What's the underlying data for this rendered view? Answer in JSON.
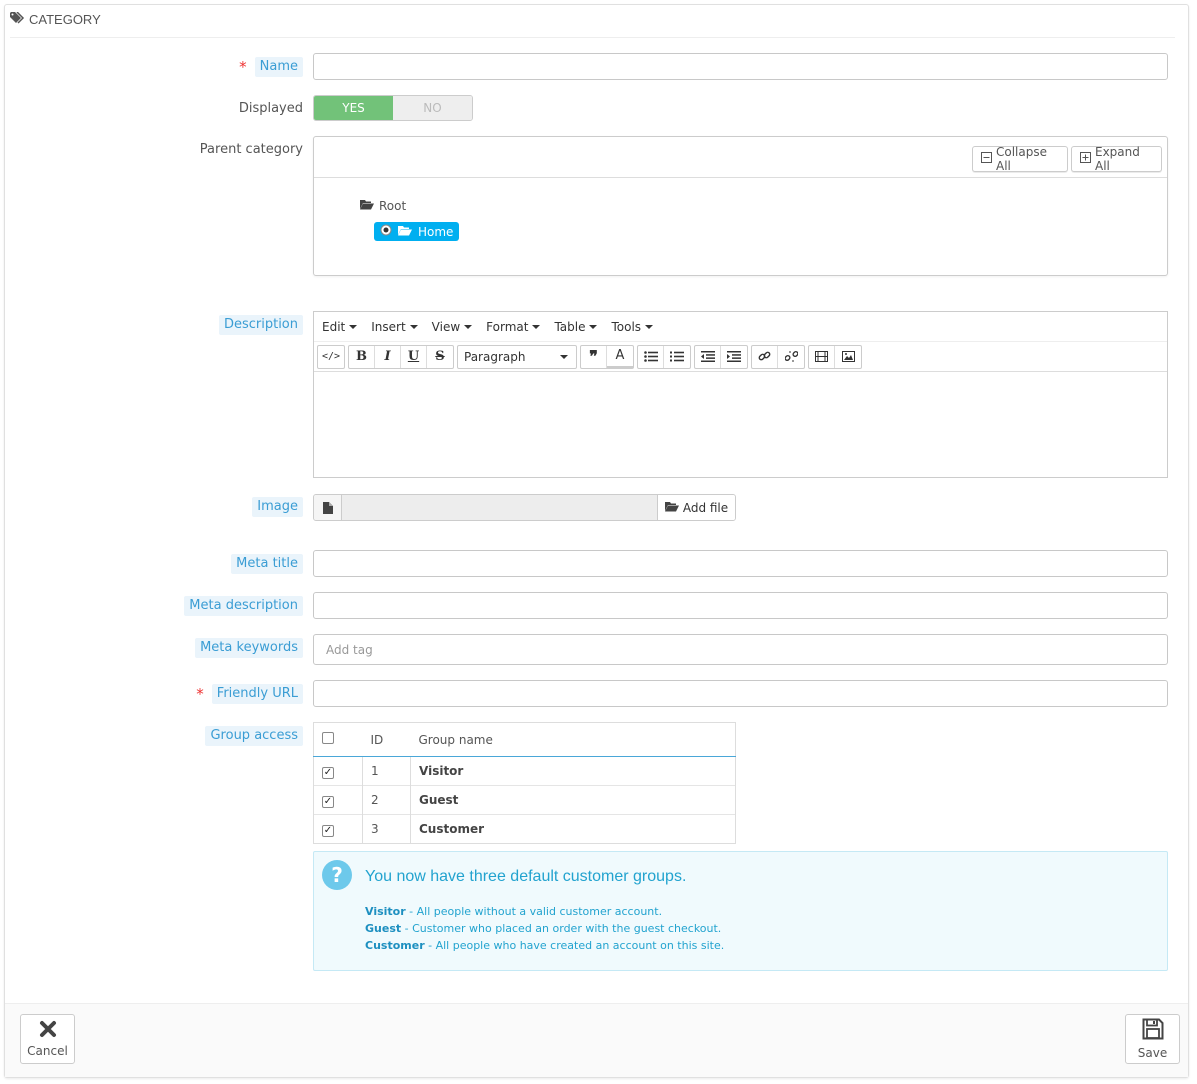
{
  "heading": {
    "title": "CATEGORY",
    "icon": "tags-icon"
  },
  "fields": {
    "name": {
      "label": "Name",
      "required": true,
      "value": ""
    },
    "displayed": {
      "label": "Displayed",
      "yes": "YES",
      "no": "NO",
      "selected": "YES",
      "yes_color": "#72c279"
    },
    "parent_category": {
      "label": "Parent category",
      "collapse_all": "Collapse All",
      "expand_all": "Expand All",
      "root": "Root",
      "home": "Home",
      "selected_color": "#00aff0"
    },
    "description": {
      "label": "Description",
      "menus": [
        "Edit",
        "Insert",
        "View",
        "Format",
        "Table",
        "Tools"
      ],
      "format_select": "Paragraph"
    },
    "image": {
      "label": "Image",
      "add_file": "Add file"
    },
    "meta_title": {
      "label": "Meta title",
      "value": ""
    },
    "meta_description": {
      "label": "Meta description",
      "value": ""
    },
    "meta_keywords": {
      "label": "Meta keywords",
      "placeholder": "Add tag"
    },
    "friendly_url": {
      "label": "Friendly URL",
      "required": true,
      "value": ""
    },
    "group_access": {
      "label": "Group access",
      "columns": [
        "ID",
        "Group name"
      ],
      "rows": [
        {
          "checked": true,
          "id": "1",
          "name": "Visitor"
        },
        {
          "checked": true,
          "id": "2",
          "name": "Guest"
        },
        {
          "checked": true,
          "id": "3",
          "name": "Customer"
        }
      ]
    }
  },
  "info": {
    "title": "You now have three default customer groups.",
    "lines": [
      {
        "term": "Visitor",
        "text": " - All people without a valid customer account."
      },
      {
        "term": "Guest",
        "text": " - Customer who placed an order with the guest checkout."
      },
      {
        "term": "Customer",
        "text": " - All people who have created an account on this site."
      }
    ]
  },
  "footer": {
    "cancel": "Cancel",
    "save": "Save"
  }
}
